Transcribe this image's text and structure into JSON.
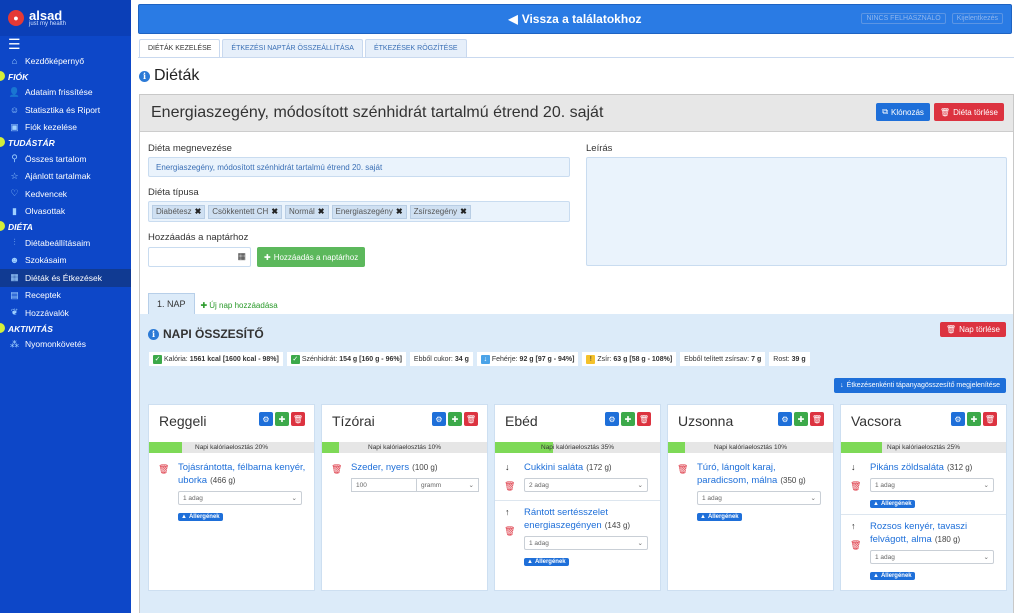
{
  "brand": {
    "name": "alsad",
    "tagline": "just my health"
  },
  "sidebar": {
    "home": "Kezdőképernyő",
    "sections": [
      {
        "title": "FIÓK",
        "items": [
          "Adataim frissítése",
          "Statisztika és Riport",
          "Fiók kezelése"
        ]
      },
      {
        "title": "TUDÁSTÁR",
        "items": [
          "Összes tartalom",
          "Ajánlott tartalmak",
          "Kedvencek",
          "Olvasottak"
        ]
      },
      {
        "title": "DIÉTA",
        "items": [
          "Diétabeállításaim",
          "Szokásaim",
          "Diéták és Étkezések",
          "Receptek",
          "Hozzávalók"
        ]
      },
      {
        "title": "AKTIVITÁS",
        "items": [
          "Nyomonkövetés"
        ]
      }
    ]
  },
  "topbar": {
    "back": "Vissza a találatokhoz",
    "hint1": "NINCS FELHASZNÁLÓ",
    "hint2": "Kijelentkezés"
  },
  "tabs": [
    "DIÉTÁK KEZELÉSE",
    "ÉTKEZÉSI NAPTÁR ÖSSZEÁLLÍTÁSA",
    "ÉTKEZÉSEK RÖGZÍTÉSE"
  ],
  "page": {
    "title": "Diéták"
  },
  "diet": {
    "name": "Energiaszegény, módosított szénhidrát tartalmú étrend 20. saját",
    "clone": "Klónozás",
    "delete": "Diéta törlése",
    "name_label": "Diéta megnevezése",
    "type_label": "Diéta típusa",
    "types": [
      "Diabétesz",
      "Csökkentett CH",
      "Normál",
      "Energiaszegény",
      "Zsírszegény"
    ],
    "calendar_label": "Hozzáadás a naptárhoz",
    "calendar_button": "Hozzáadás a naptárhoz",
    "desc_label": "Leírás"
  },
  "day": {
    "tab": "1. NAP",
    "new": "Új nap hozzáadása",
    "summary_title": "NAPI ÖSSZESÍTŐ",
    "delete": "Nap törlése",
    "show_button": "Étkezésenkénti tápanyagösszesítő megjelenítése",
    "stats": [
      {
        "label": "Kalória:",
        "value": "1561 kcal [1600 kcal - 98%]",
        "icon": "ok"
      },
      {
        "label": "Szénhidrát:",
        "value": "154 g [160 g - 96%]",
        "icon": "ok"
      },
      {
        "label": "Ebből cukor:",
        "value": "34 g",
        "icon": ""
      },
      {
        "label": "Fehérje:",
        "value": "92 g [97 g - 94%]",
        "icon": "dn"
      },
      {
        "label": "Zsír:",
        "value": "63 g [58 g - 108%]",
        "icon": "wr"
      },
      {
        "label": "Ebből telített zsírsav:",
        "value": "7 g",
        "icon": ""
      },
      {
        "label": "Rost:",
        "value": "39 g",
        "icon": ""
      }
    ]
  },
  "meals": [
    {
      "name": "Reggeli",
      "bar": "Napi kalóriaelosztás 20%",
      "pct": 20,
      "items": [
        {
          "name": "Tojásrántotta, félbarna kenyér, uborka",
          "g": "(466 g)",
          "sel": "1 adag",
          "allergen": "Allergének",
          "arrow": ""
        }
      ]
    },
    {
      "name": "Tízórai",
      "bar": "Napi kalóriaelosztás 10%",
      "pct": 10,
      "items": [
        {
          "name": "Szeder, nyers",
          "g": "(100 g)",
          "qty": "100",
          "unit": "gramm"
        }
      ]
    },
    {
      "name": "Ebéd",
      "bar": "Napi kalóriaelosztás 35%",
      "pct": 35,
      "items": [
        {
          "name": "Cukkini saláta",
          "g": "(172 g)",
          "sel": "2 adag",
          "arrow": "↓"
        },
        {
          "name": "Rántott sertésszelet energiaszegényen",
          "g": "(143 g)",
          "sel": "1 adag",
          "allergen": "Allergének",
          "arrow": "↑"
        }
      ]
    },
    {
      "name": "Uzsonna",
      "bar": "Napi kalóriaelosztás 10%",
      "pct": 10,
      "items": [
        {
          "name": "Túró, lángolt karaj, paradicsom, málna",
          "g": "(350 g)",
          "sel": "1 adag",
          "allergen": "Allergének"
        }
      ]
    },
    {
      "name": "Vacsora",
      "bar": "Napi kalóriaelosztás 25%",
      "pct": 25,
      "items": [
        {
          "name": "Pikáns zöldsaláta",
          "g": "(312 g)",
          "sel": "1 adag",
          "allergen": "Allergének",
          "arrow": "↓"
        },
        {
          "name": "Rozsos kenyér, tavaszi felvágott, alma",
          "g": "(180 g)",
          "sel": "1 adag",
          "allergen": "Allergének",
          "arrow": "↑"
        }
      ]
    }
  ]
}
